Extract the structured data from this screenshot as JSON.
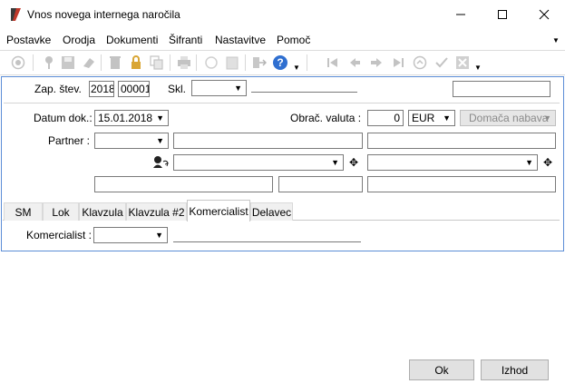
{
  "window": {
    "title": "Vnos novega internega naročila",
    "minimize_icon": "minimize-icon",
    "maximize_icon": "maximize-icon",
    "close_icon": "close-icon"
  },
  "menu": {
    "items": [
      "Postavke",
      "Orodja",
      "Dokumenti",
      "Šifranti",
      "Nastavitve",
      "Pomoč"
    ]
  },
  "toolbar": {
    "icons": [
      "refresh-icon",
      "pin-icon",
      "save-icon",
      "eraser-icon",
      "delete-icon",
      "lock-icon",
      "copy-icon",
      "print-icon",
      "attach-icon",
      "clipboard-icon",
      "exit-icon",
      "help-icon",
      "first-icon",
      "prev-icon",
      "next-icon",
      "last-icon",
      "up-icon",
      "confirm-icon",
      "cancel-icon"
    ]
  },
  "header": {
    "zap_stev_label": "Zap. štev.",
    "year_value": "2018",
    "number_value": "00001",
    "skl_label": "Skl.",
    "skl_value": ""
  },
  "document": {
    "datum_label": "Datum dok.:",
    "datum_value": "15.01.2018",
    "obrac_label": "Obrač. valuta :",
    "rate_value": "0",
    "currency_value": "EUR",
    "nabava_value": "Domača nabava",
    "partner_label": "Partner :"
  },
  "tabs": {
    "items": [
      "SM",
      "Lok",
      "Klavzula",
      "Klavzula #2",
      "Komercialist",
      "Delavec"
    ],
    "active": "Komercialist"
  },
  "komercialist": {
    "label": "Komercialist :"
  },
  "buttons": {
    "ok": "Ok",
    "izhod": "Izhod"
  },
  "colors": {
    "accent_border": "#5b8dd6",
    "help_blue": "#2f6fd0"
  }
}
